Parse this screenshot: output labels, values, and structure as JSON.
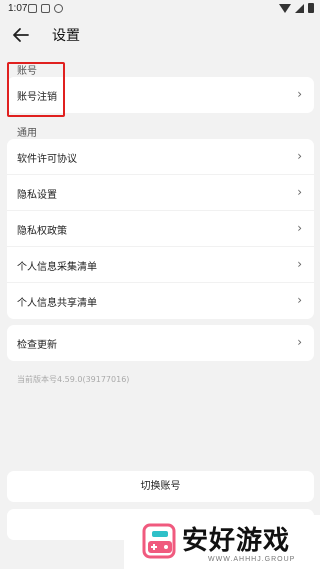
{
  "status_bar": {
    "time": "1:07"
  },
  "header": {
    "title": "设置"
  },
  "sections": {
    "account": {
      "label": "账号",
      "items": [
        {
          "label": "账号注销"
        }
      ]
    },
    "general": {
      "label": "通用",
      "items": [
        {
          "label": "软件许可协议"
        },
        {
          "label": "隐私设置"
        },
        {
          "label": "隐私权政策"
        },
        {
          "label": "个人信息采集清单"
        },
        {
          "label": "个人信息共享清单"
        }
      ]
    },
    "update": {
      "items": [
        {
          "label": "检查更新"
        }
      ]
    }
  },
  "version_text": "当前版本号4.59.0(39177016)",
  "buttons": {
    "switch_account": "切换账号"
  },
  "chevron": "›",
  "watermark": {
    "text": "安好游戏",
    "url": "WWW.AHHHJ.GROUP"
  }
}
